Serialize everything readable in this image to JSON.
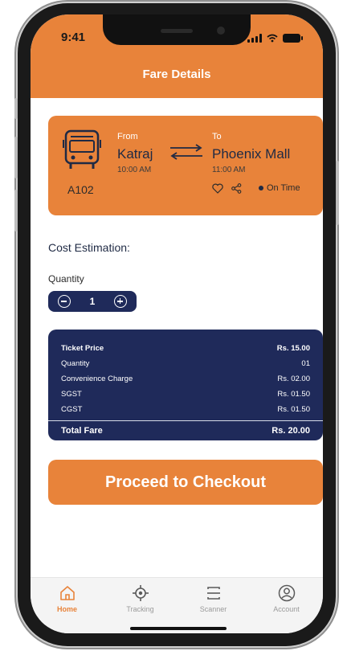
{
  "status_bar": {
    "time": "9:41"
  },
  "header": {
    "title": "Fare Details"
  },
  "trip": {
    "route_id": "A102",
    "from_label": "From",
    "from_place": "Katraj",
    "from_time": "10:00 AM",
    "to_label": "To",
    "to_place": "Phoenix Mall",
    "to_time": "11:00 AM",
    "status": "On Time"
  },
  "cost": {
    "section_title": "Cost Estimation:",
    "quantity_label": "Quantity",
    "quantity_value": "1"
  },
  "fare": {
    "rows": [
      {
        "label": "Ticket Price",
        "value": "Rs. 15.00"
      },
      {
        "label": "Quantity",
        "value": "01"
      },
      {
        "label": "Convenience Charge",
        "value": "Rs. 02.00"
      },
      {
        "label": "SGST",
        "value": "Rs. 01.50"
      },
      {
        "label": "CGST",
        "value": "Rs. 01.50"
      }
    ],
    "total_label": "Total Fare",
    "total_value": "Rs. 20.00"
  },
  "checkout": {
    "label": "Proceed to Checkout"
  },
  "nav": {
    "items": [
      {
        "label": "Home",
        "icon": "home-icon"
      },
      {
        "label": "Tracking",
        "icon": "target-icon"
      },
      {
        "label": "Scanner",
        "icon": "scanner-icon"
      },
      {
        "label": "Account",
        "icon": "user-icon"
      }
    ]
  },
  "colors": {
    "accent": "#E8833A",
    "navy": "#1F2A5A"
  }
}
